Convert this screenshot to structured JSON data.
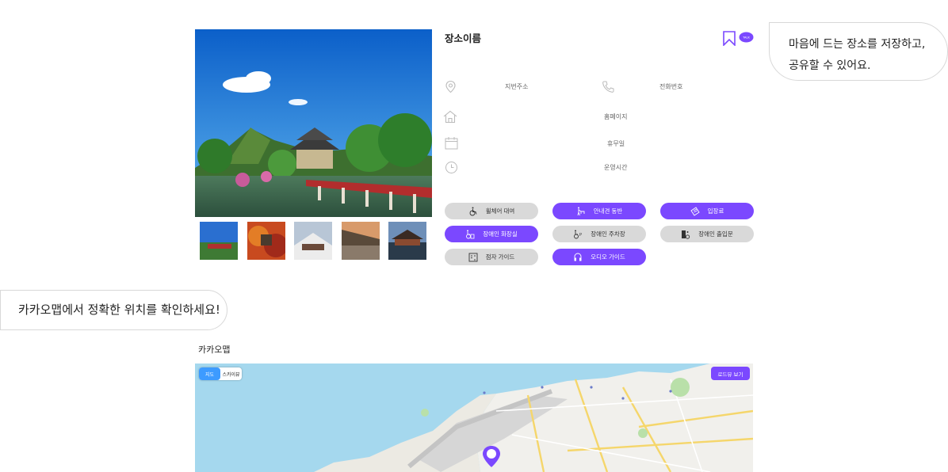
{
  "place": {
    "name": "장소이름",
    "address_label": "지번주소",
    "phone_label": "전화번호",
    "homepage_label": "홈페이지",
    "holiday_label": "휴무일",
    "hours_label": "운영시간"
  },
  "icons": {
    "bookmark": "bookmark-icon",
    "talk": "kakaotalk-share-icon",
    "talk_text": "TALK"
  },
  "features": [
    {
      "label": "휠체어 대여",
      "icon": "wheelchair-icon",
      "active": false
    },
    {
      "label": "안내견 동반",
      "icon": "guide-dog-icon",
      "active": true
    },
    {
      "label": "입장료",
      "icon": "ticket-icon",
      "active": true
    },
    {
      "label": "장애인 화장실",
      "icon": "accessible-toilet-icon",
      "active": true
    },
    {
      "label": "장애인 주차장",
      "icon": "accessible-parking-icon",
      "active": false
    },
    {
      "label": "장애인 출입문",
      "icon": "accessible-door-icon",
      "active": false
    },
    {
      "label": "점자 가이드",
      "icon": "braille-icon",
      "active": false
    },
    {
      "label": "오디오 가이드",
      "icon": "audio-guide-icon",
      "active": true
    }
  ],
  "bubbles": {
    "save_share_line1": "마음에 드는 장소를 저장하고,",
    "save_share_line2": "공유할 수 있어요.",
    "map_hint": "카카오맵에서 정확한 위치를 확인하세요!"
  },
  "map": {
    "title": "카카오맵",
    "tab_map": "지도",
    "tab_sky": "스카이뷰",
    "roadview": "로드뷰 보기"
  },
  "colors": {
    "accent": "#7b48ff",
    "inactive": "#d9d9d9",
    "map_tab_on": "#3d9bff"
  }
}
